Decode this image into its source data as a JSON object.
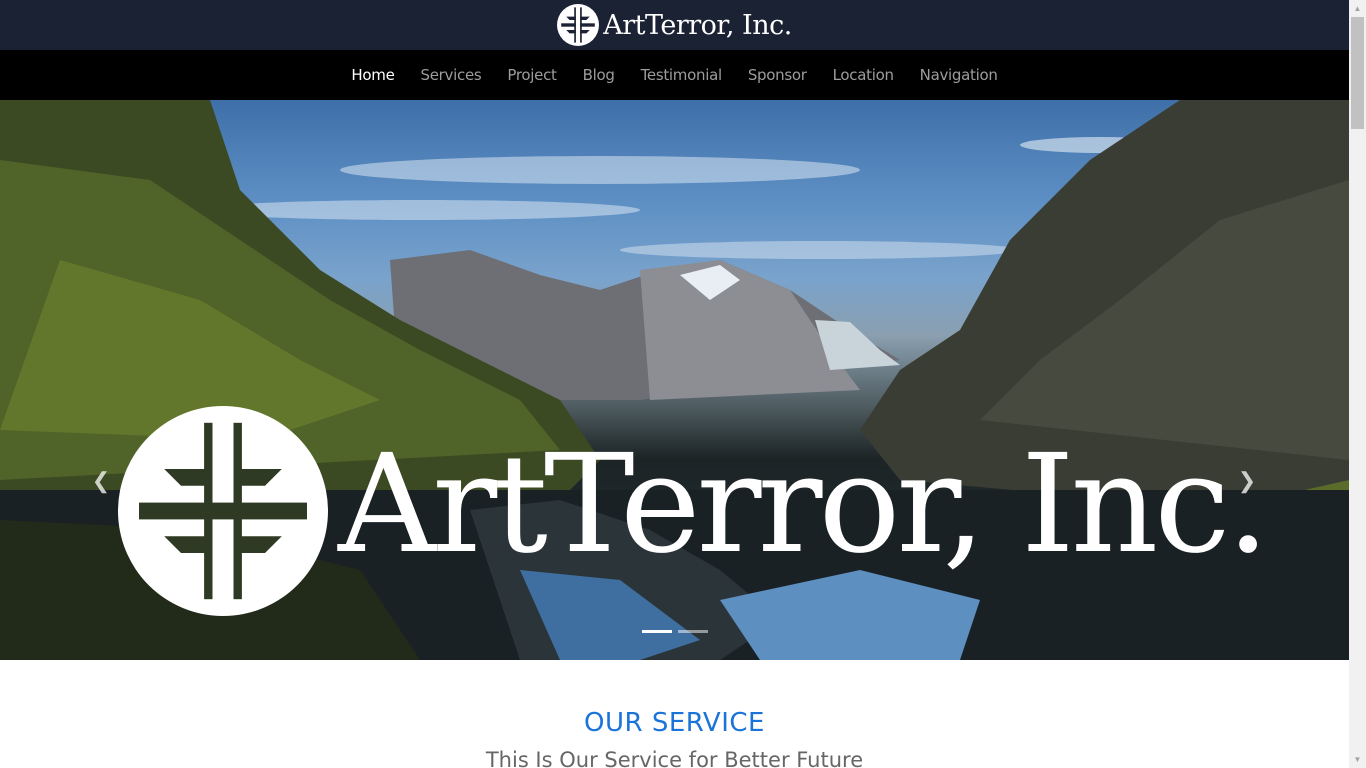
{
  "brand": {
    "name": "ArtTerror, Inc."
  },
  "nav": {
    "items": [
      {
        "label": "Home",
        "active": true
      },
      {
        "label": "Services"
      },
      {
        "label": "Project"
      },
      {
        "label": "Blog"
      },
      {
        "label": "Testimonial"
      },
      {
        "label": "Sponsor"
      },
      {
        "label": "Location"
      },
      {
        "label": "Navigation"
      }
    ]
  },
  "hero": {
    "title": "ArtTerror, Inc.",
    "prev_icon": "chevron-left-icon",
    "next_icon": "chevron-right-icon",
    "slide_count": 2,
    "active_slide": 1
  },
  "service": {
    "title": "OUR SERVICE",
    "subtitle": "This Is Our Service for Better Future"
  },
  "colors": {
    "brandbar": "#1b2234",
    "navbar": "#000000",
    "accent": "#1a73d9",
    "nav_inactive": "#9d9d9d",
    "nav_active": "#ffffff"
  }
}
